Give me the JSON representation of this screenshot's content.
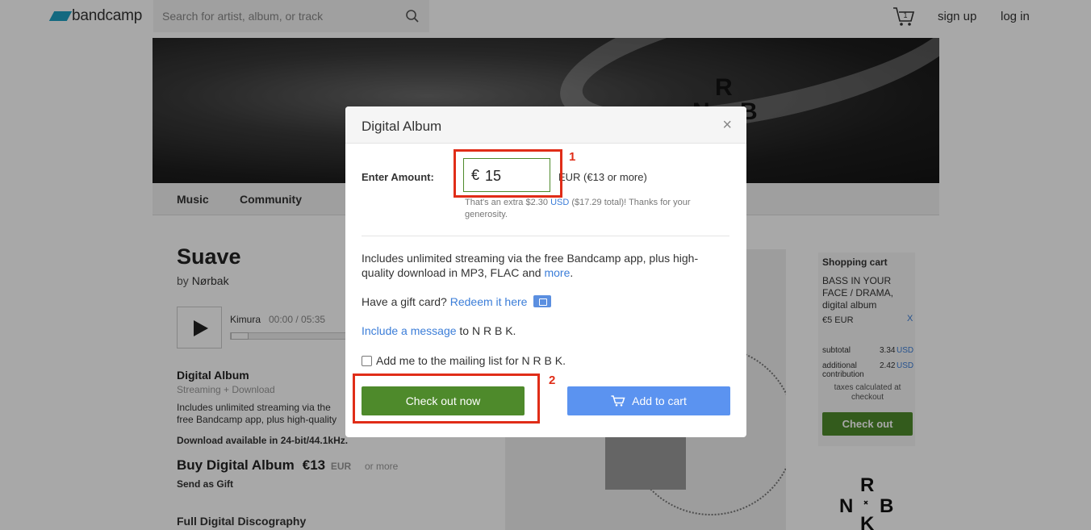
{
  "header": {
    "logo_text": "bandcamp",
    "search_placeholder": "Search for artist, album, or track",
    "cart_count": "1",
    "signup_label": "sign up",
    "login_label": "log in"
  },
  "hero": {
    "letters": [
      "R",
      "N",
      "B"
    ]
  },
  "nav": {
    "tabs": [
      "Music",
      "Community"
    ]
  },
  "album": {
    "title": "Suave",
    "by_prefix": "by",
    "artist": "Nørbak",
    "track_name": "Kimura",
    "track_time": "00:00 / 05:35",
    "digital_album_title": "Digital Album",
    "digital_album_sub": "Streaming + Download",
    "digital_album_desc": "Includes unlimited streaming via the free Bandcamp app, plus high-quality download in MP3, FLAC and more.",
    "download_info": "Download available in 24-bit/44.1kHz.",
    "buy_label": "Buy Digital Album",
    "buy_price": "€13",
    "buy_currency": "EUR",
    "buy_or_more": "or more",
    "send_gift": "Send as Gift",
    "full_discography": "Full Digital Discography"
  },
  "cart": {
    "title": "Shopping cart",
    "item": "BASS IN YOUR FACE / DRAMA, digital album",
    "item_price": "€5 EUR",
    "remove": "X",
    "subtotal_label": "subtotal",
    "subtotal_amount": "3.34",
    "subtotal_currency": "USD",
    "contribution_label": "additional contribution",
    "contribution_amount": "2.42",
    "contribution_currency": "USD",
    "taxes_note": "taxes calculated at checkout",
    "checkout_label": "Check out"
  },
  "modal": {
    "title": "Digital Album",
    "close": "×",
    "enter_amount_label": "Enter Amount:",
    "currency_symbol": "€",
    "amount_value": "15",
    "amount_unit": "EUR (€13 or more)",
    "extra_note_prefix": "That's an extra $2.30",
    "extra_note_link": "USD",
    "extra_note_suffix": "($17.29 total)! Thanks for your generosity.",
    "includes_text": "Includes unlimited streaming via the free Bandcamp app, plus high-quality download in MP3, FLAC and",
    "includes_link": "more",
    "includes_end": ".",
    "gift_card_text": "Have a gift card?",
    "gift_card_link": "Redeem it here",
    "message_link": "Include a message",
    "message_suffix": "to N R B K.",
    "mailing_list_label": "Add me to the mailing list for N R B K.",
    "checkout_now_label": "Check out now",
    "add_to_cart_label": "Add to cart"
  },
  "annotations": {
    "label_1": "1",
    "label_2": "2"
  },
  "colors": {
    "accent_green": "#4e8a2b",
    "accent_blue": "#5b93f0",
    "link_blue": "#3b7dd8",
    "annotation_red": "#e02d18"
  }
}
